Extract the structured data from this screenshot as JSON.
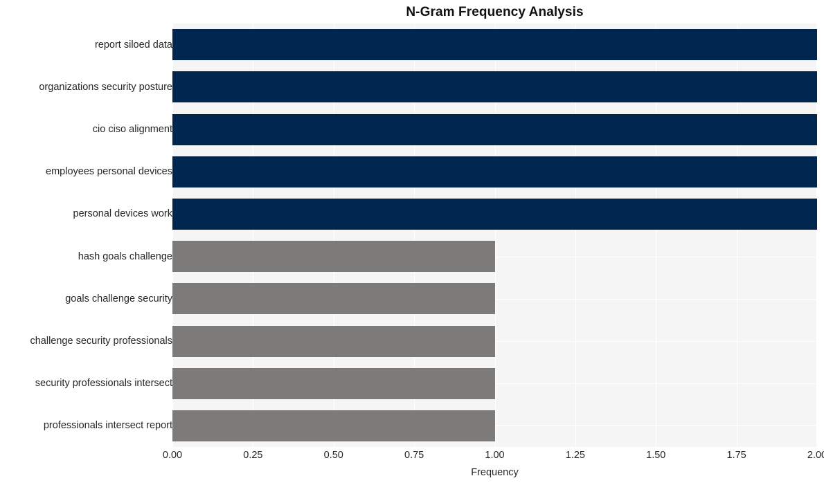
{
  "chart_data": {
    "type": "bar",
    "orientation": "horizontal",
    "title": "N-Gram Frequency Analysis",
    "xlabel": "Frequency",
    "ylabel": "",
    "xlim": [
      0.0,
      2.0
    ],
    "xticks": [
      "0.00",
      "0.25",
      "0.50",
      "0.75",
      "1.00",
      "1.25",
      "1.50",
      "1.75",
      "2.00"
    ],
    "xtick_values": [
      0.0,
      0.25,
      0.5,
      0.75,
      1.0,
      1.25,
      1.5,
      1.75,
      2.0
    ],
    "grid": true,
    "legend": "none",
    "categories": [
      "report siloed data",
      "organizations security posture",
      "cio ciso alignment",
      "employees personal devices",
      "personal devices work",
      "hash goals challenge",
      "goals challenge security",
      "challenge security professionals",
      "security professionals intersect",
      "professionals intersect report"
    ],
    "values": [
      2,
      2,
      2,
      2,
      2,
      1,
      1,
      1,
      1,
      1
    ],
    "bar_colors": [
      "#00254f",
      "#00254f",
      "#00254f",
      "#00254f",
      "#00254f",
      "#7c7b79",
      "#7c7b79",
      "#7c7b79",
      "#7c7b79",
      "#7c7b79"
    ],
    "colors": {
      "high": "#00254f",
      "low": "#7c7b79",
      "plot_background": "#f5f5f5",
      "figure_background": "#ffffff",
      "grid": "#ffffff",
      "text": "#262626",
      "title": "#111111"
    }
  }
}
